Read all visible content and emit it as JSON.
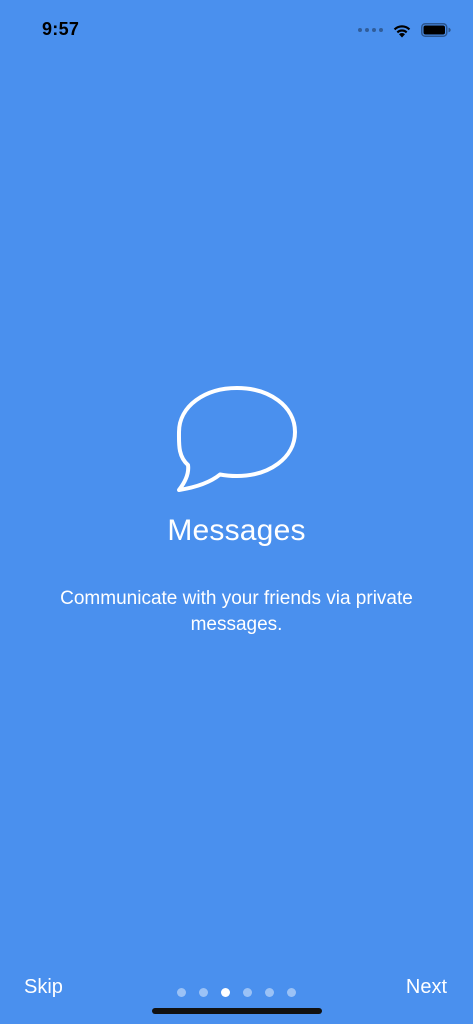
{
  "status_bar": {
    "time": "9:57"
  },
  "onboarding": {
    "icon": "speech-bubble-icon",
    "title": "Messages",
    "description": "Communicate with your friends via private messages."
  },
  "controls": {
    "skip_label": "Skip",
    "next_label": "Next",
    "page_count": 6,
    "current_page": 3
  },
  "colors": {
    "background": "#4A90EE",
    "foreground": "#FFFFFF"
  }
}
